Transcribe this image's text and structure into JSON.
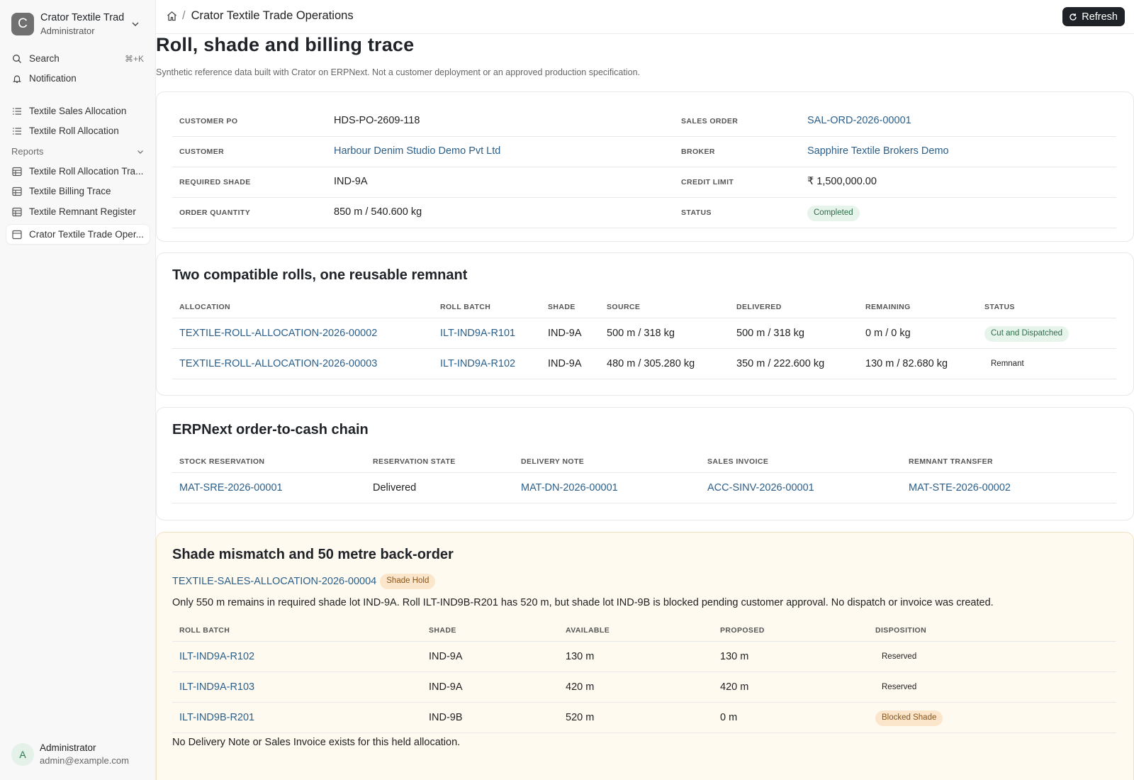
{
  "workspace": {
    "initial": "C",
    "name": "Crator Textile Trad",
    "role": "Administrator"
  },
  "sidebar": {
    "search_label": "Search",
    "search_shortcut": "⌘+K",
    "notification_label": "Notification",
    "items": [
      {
        "label": "Textile Sales Allocation"
      },
      {
        "label": "Textile Roll Allocation"
      }
    ],
    "reports_label": "Reports",
    "reports": [
      {
        "label": "Textile Roll Allocation Tra..."
      },
      {
        "label": "Textile Billing Trace"
      },
      {
        "label": "Textile Remnant Register"
      },
      {
        "label": "Crator Textile Trade Oper..."
      }
    ]
  },
  "user": {
    "initial": "A",
    "name": "Administrator",
    "email": "admin@example.com"
  },
  "header": {
    "breadcrumb": "Crator Textile Trade Operations",
    "refresh_label": "Refresh"
  },
  "page": {
    "title": "Roll, shade and billing trace",
    "subtitle": "Synthetic reference data built with Crator on ERPNext. Not a customer deployment or an approved production specification."
  },
  "summary": {
    "rows": [
      {
        "k1": "CUSTOMER PO",
        "v1": "HDS-PO-2609-118",
        "k2": "SALES ORDER",
        "v2": "SAL-ORD-2026-00001"
      },
      {
        "k1": "CUSTOMER",
        "v1": "Harbour Denim Studio Demo Pvt Ltd",
        "k2": "BROKER",
        "v2": "Sapphire Textile Brokers Demo"
      },
      {
        "k1": "REQUIRED SHADE",
        "v1": "IND-9A",
        "k2": "CREDIT LIMIT",
        "v2": "₹ 1,500,000.00"
      },
      {
        "k1": "ORDER QUANTITY",
        "v1": "850 m / 540.600 kg",
        "k2": "STATUS",
        "v2": "Completed"
      }
    ]
  },
  "rolls": {
    "title": "Two compatible rolls, one reusable remnant",
    "headers": [
      "ALLOCATION",
      "ROLL BATCH",
      "SHADE",
      "SOURCE",
      "DELIVERED",
      "REMAINING",
      "STATUS"
    ],
    "rows": [
      {
        "allocation": "TEXTILE-ROLL-ALLOCATION-2026-00002",
        "batch": "ILT-IND9A-R101",
        "shade": "IND-9A",
        "source": "500 m / 318 kg",
        "delivered": "500 m / 318 kg",
        "remaining": "0 m / 0 kg",
        "status": "Cut and Dispatched"
      },
      {
        "allocation": "TEXTILE-ROLL-ALLOCATION-2026-00003",
        "batch": "ILT-IND9A-R102",
        "shade": "IND-9A",
        "source": "480 m / 305.280 kg",
        "delivered": "350 m / 222.600 kg",
        "remaining": "130 m / 82.680 kg",
        "status": "Remnant"
      }
    ]
  },
  "chain": {
    "title": "ERPNext order-to-cash chain",
    "headers": [
      "STOCK RESERVATION",
      "RESERVATION STATE",
      "DELIVERY NOTE",
      "SALES INVOICE",
      "REMNANT TRANSFER"
    ],
    "row": {
      "reservation": "MAT-SRE-2026-00001",
      "state": "Delivered",
      "delivery": "MAT-DN-2026-00001",
      "invoice": "ACC-SINV-2026-00001",
      "transfer": "MAT-STE-2026-00002"
    }
  },
  "mismatch": {
    "title": "Shade mismatch and 50 metre back-order",
    "allocation": "TEXTILE-SALES-ALLOCATION-2026-00004",
    "badge": "Shade Hold",
    "text": "Only 550 m remains in required shade lot IND-9A. Roll ILT-IND9B-R201 has 520 m, but shade lot IND-9B is blocked pending customer approval. No dispatch or invoice was created.",
    "headers": [
      "ROLL BATCH",
      "SHADE",
      "AVAILABLE",
      "PROPOSED",
      "DISPOSITION"
    ],
    "rows": [
      {
        "batch": "ILT-IND9A-R102",
        "shade": "IND-9A",
        "available": "130 m",
        "proposed": "130 m",
        "disposition": "Reserved"
      },
      {
        "batch": "ILT-IND9A-R103",
        "shade": "IND-9A",
        "available": "420 m",
        "proposed": "420 m",
        "disposition": "Reserved"
      },
      {
        "batch": "ILT-IND9B-R201",
        "shade": "IND-9B",
        "available": "520 m",
        "proposed": "0 m",
        "disposition": "Blocked Shade"
      }
    ],
    "footer": "No Delivery Note or Sales Invoice exists for this held allocation."
  }
}
